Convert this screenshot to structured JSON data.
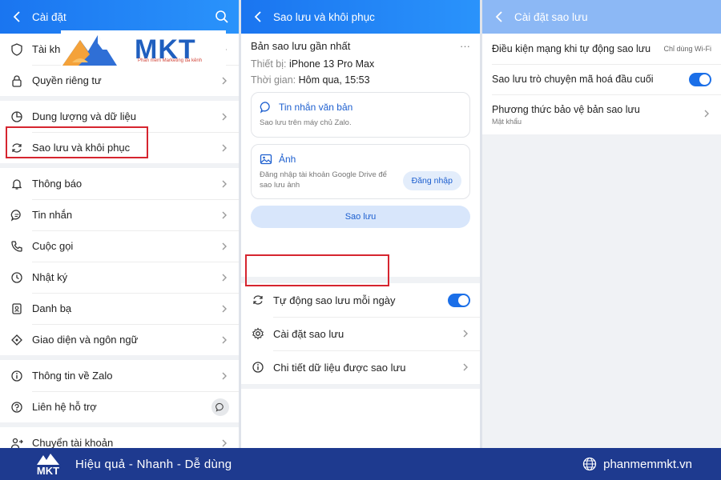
{
  "colors": {
    "accent": "#1b6fe8",
    "highlight": "#d6252f",
    "footer": "#1e3a8f"
  },
  "brand": {
    "logo_text": "MKT",
    "logo_tagline": "Phần mềm Marketing đa kênh"
  },
  "panel1": {
    "title": "Cài đặt",
    "items": [
      {
        "label": "Tài khoản",
        "icon": "shield-icon"
      },
      {
        "label": "Quyền riêng tư",
        "icon": "lock-icon"
      },
      {
        "label": "Dung lượng và dữ liệu",
        "icon": "pie-chart-icon"
      },
      {
        "label": "Sao lưu và khôi phục",
        "icon": "sync-icon"
      },
      {
        "label": "Thông báo",
        "icon": "bell-icon"
      },
      {
        "label": "Tin nhắn",
        "icon": "chat-icon"
      },
      {
        "label": "Cuộc gọi",
        "icon": "phone-icon"
      },
      {
        "label": "Nhật ký",
        "icon": "clock-icon"
      },
      {
        "label": "Danh bạ",
        "icon": "contacts-icon"
      },
      {
        "label": "Giao diện và ngôn ngữ",
        "icon": "brush-icon"
      },
      {
        "label": "Thông tin về Zalo",
        "icon": "info-icon"
      },
      {
        "label": "Liên hệ hỗ trợ",
        "icon": "help-icon"
      },
      {
        "label": "Chuyển tài khoản",
        "icon": "switch-account-icon"
      }
    ]
  },
  "panel2": {
    "title": "Sao lưu và khôi phục",
    "latest_title": "Bản sao lưu gần nhất",
    "more": "···",
    "device_label": "Thiết bị:",
    "device_value": "iPhone 13 Pro Max",
    "time_label": "Thời gian:",
    "time_value": "Hôm qua, 15:53",
    "messages_title": "Tin nhắn văn bản",
    "messages_desc": "Sao lưu trên máy chủ Zalo.",
    "photos_title": "Ảnh",
    "photos_desc": "Đăng nhập tài khoản Google Drive để sao lưu ảnh",
    "login_button": "Đăng nhập",
    "backup_button": "Sao lưu",
    "auto_backup": "Tự động sao lưu mỗi ngày",
    "auto_backup_on": true,
    "settings": "Cài đặt sao lưu",
    "details": "Chi tiết dữ liệu được sao lưu"
  },
  "panel3": {
    "title": "Cài đặt sao lưu",
    "network_label": "Điều kiện mạng khi tự động sao lưu",
    "network_value": "Chỉ dùng Wi-Fi",
    "e2ee_label": "Sao lưu trò chuyện mã hoá đầu cuối",
    "e2ee_on": true,
    "protect_label": "Phương thức bảo vệ bản sao lưu",
    "protect_value": "Mật khẩu"
  },
  "footer": {
    "logo_text": "MKT",
    "slogan": "Hiệu quả - Nhanh - Dễ dùng",
    "site": "phanmemmkt.vn"
  }
}
